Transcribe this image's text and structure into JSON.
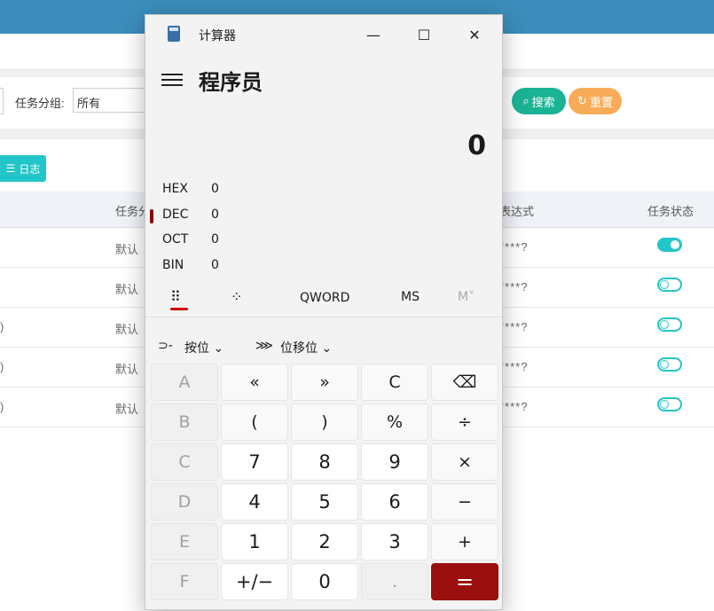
{
  "background": {
    "filter": {
      "label": "任务分组:",
      "select_value": "所有"
    },
    "buttons": {
      "search": "搜索",
      "reset": "重置",
      "log": "日志"
    },
    "table": {
      "headers": [
        "任务分",
        "表达式",
        "任务状态"
      ],
      "rows": [
        {
          "prefix": "",
          "group": "默认",
          "expr": "****?",
          "status": true
        },
        {
          "prefix": "",
          "group": "默认",
          "expr": "****?",
          "status": false
        },
        {
          "prefix": ")",
          "group": "默认",
          "expr": "****?",
          "status": false
        },
        {
          "prefix": ")",
          "group": "默认",
          "expr": "****?",
          "status": false
        },
        {
          "prefix": ")",
          "group": "默认",
          "expr": "****?",
          "status": false
        }
      ]
    },
    "colors": {
      "header_bar": "#3c8dbc",
      "search": "#1ab394",
      "reset": "#f8ac59",
      "toggle": "#23c6c8"
    }
  },
  "calculator": {
    "window_title": "计算器",
    "mode": "程序员",
    "display": "0",
    "radix": [
      {
        "name": "HEX",
        "value": "0"
      },
      {
        "name": "DEC",
        "value": "0",
        "selected": true
      },
      {
        "name": "OCT",
        "value": "0"
      },
      {
        "name": "BIN",
        "value": "0"
      }
    ],
    "tabs": {
      "word": "QWORD",
      "ms": "MS",
      "mv": "M˅"
    },
    "bit_menu": {
      "bitwise": "按位",
      "shift": "位移位"
    },
    "keys": [
      {
        "label": "A",
        "kind": "dim"
      },
      {
        "label": "«",
        "kind": "op"
      },
      {
        "label": "»",
        "kind": "op"
      },
      {
        "label": "C",
        "kind": "op"
      },
      {
        "label": "⌫",
        "kind": "op"
      },
      {
        "label": "B",
        "kind": "dim"
      },
      {
        "label": "(",
        "kind": "op"
      },
      {
        "label": ")",
        "kind": "op"
      },
      {
        "label": "%",
        "kind": "op"
      },
      {
        "label": "÷",
        "kind": "op"
      },
      {
        "label": "C",
        "kind": "dim"
      },
      {
        "label": "7",
        "kind": "num"
      },
      {
        "label": "8",
        "kind": "num"
      },
      {
        "label": "9",
        "kind": "num"
      },
      {
        "label": "×",
        "kind": "op"
      },
      {
        "label": "D",
        "kind": "dim"
      },
      {
        "label": "4",
        "kind": "num"
      },
      {
        "label": "5",
        "kind": "num"
      },
      {
        "label": "6",
        "kind": "num"
      },
      {
        "label": "−",
        "kind": "op"
      },
      {
        "label": "E",
        "kind": "dim"
      },
      {
        "label": "1",
        "kind": "num"
      },
      {
        "label": "2",
        "kind": "num"
      },
      {
        "label": "3",
        "kind": "num"
      },
      {
        "label": "+",
        "kind": "op"
      },
      {
        "label": "F",
        "kind": "dim"
      },
      {
        "label": "+/−",
        "kind": "num"
      },
      {
        "label": "0",
        "kind": "num"
      },
      {
        "label": ".",
        "kind": "dim"
      },
      {
        "label": "=",
        "kind": "eq"
      }
    ],
    "colors": {
      "equals": "#9b0e0e",
      "indicator": "#8b0000"
    }
  }
}
